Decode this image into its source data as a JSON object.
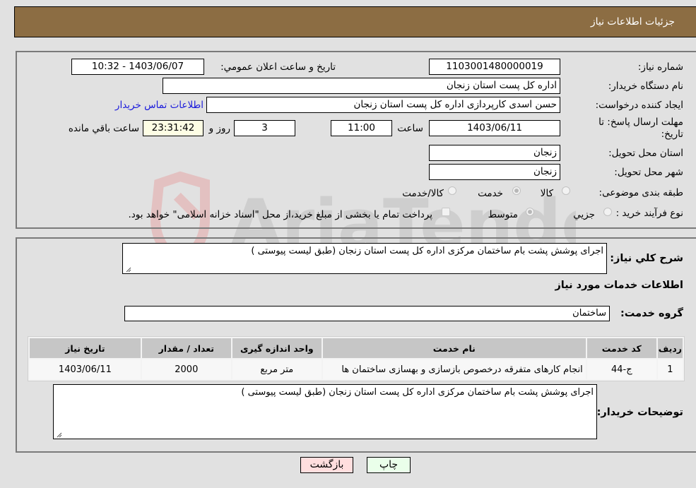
{
  "header": {
    "title": "جزئیات اطلاعات نیاز"
  },
  "form": {
    "need_number": {
      "label": "شماره نیاز:",
      "value": "1103001480000019"
    },
    "announce_datetime": {
      "label": "تاریخ و ساعت اعلان عمومي:",
      "value": "1403/06/07 - 10:32"
    },
    "buyer_org": {
      "label": "نام دستگاه خريدار:",
      "value": "اداره کل پست استان زنجان"
    },
    "requester": {
      "label": "ایجاد کننده درخواست:",
      "value": "حسن  اسدی کارپردازی اداره کل پست استان زنجان"
    },
    "buyer_contact_link": "اطلاعات تماس خریدار",
    "deadline": {
      "label": "مهلت ارسال پاسخ: تا تاریخ:",
      "date": "1403/06/11",
      "time_label": "ساعت",
      "time": "11:00",
      "days": "3",
      "days_label": "روز و",
      "remaining": "23:31:42",
      "remaining_label": "ساعت باقي مانده"
    },
    "delivery_province": {
      "label": "استان محل تحویل:",
      "value": "زنجان"
    },
    "delivery_city": {
      "label": "شهر محل تحویل:",
      "value": "زنجان"
    },
    "category": {
      "label": "طبقه بندی موضوعی:",
      "options": [
        "کالا",
        "خدمت",
        "کالا/خدمت"
      ],
      "selected": "خدمت"
    },
    "purchase_type": {
      "label": "نوع فرآیند خرید :",
      "options": [
        "جزيي",
        "متوسط"
      ],
      "selected": "متوسط",
      "treasury_note": "پرداخت تمام یا بخشی از مبلغ خرید،از محل \"اسناد خزانه اسلامی\" خواهد بود."
    }
  },
  "details": {
    "summary_label": "شرح کلي نياز:",
    "summary_value": "اجرای پوشش پشت بام ساختمان مرکزی اداره کل پست استان زنجان (طبق لیست پیوستی )",
    "services_heading": "اطلاعات خدمات مورد نياز",
    "service_group_label": "گروه خدمت:",
    "service_group_value": "ساختمان",
    "table": {
      "headers": [
        "رديف",
        "کد خدمت",
        "نام خدمت",
        "واحد اندازه گيری",
        "تعداد / مقدار",
        "تاريخ نياز"
      ],
      "rows": [
        [
          "1",
          "ج-44",
          "انجام کارهای متفرقه درخصوص بازسازی و بهسازی ساختمان ها",
          "متر مربع",
          "2000",
          "1403/06/11"
        ]
      ]
    },
    "buyer_notes_label": "توضيحات خريدار:",
    "buyer_notes_value": "اجرای پوشش پشت بام ساختمان مرکزی اداره کل پست استان زنجان (طبق لیست پیوستی )"
  },
  "buttons": {
    "print": "چاپ",
    "back": "بازگشت"
  },
  "colors": {
    "header_bg": "#8c6d43",
    "print_bg": "#eaffea",
    "back_bg": "#ffdede",
    "link": "#1a1adc"
  }
}
